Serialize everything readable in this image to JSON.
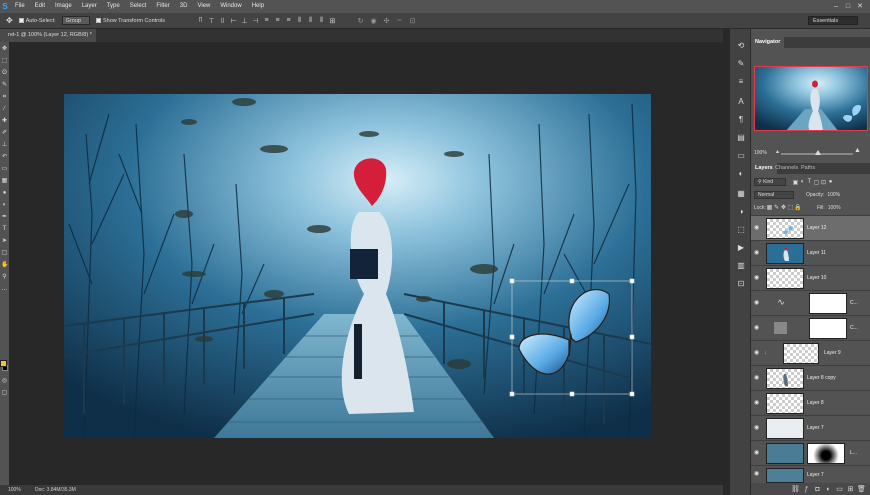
{
  "app": {
    "logo": "S"
  },
  "menu": [
    "File",
    "Edit",
    "Image",
    "Layer",
    "Type",
    "Select",
    "Filter",
    "3D",
    "View",
    "Window",
    "Help"
  ],
  "window_controls": [
    "–",
    "□",
    "✕"
  ],
  "options": {
    "auto_select_label": "Auto-Select:",
    "auto_select_value": "Group",
    "show_transform_label": "Show Transform Controls",
    "workspace": "Essentials"
  },
  "document": {
    "tab_title": "ret-1 @ 100% (Layer 12, RGB/8) *",
    "zoom": "100%",
    "doc_info": "Doc: 3.84M/35.3M"
  },
  "navigator": {
    "tab": "Navigator",
    "zoom": "100%"
  },
  "layers_panel": {
    "tabs": [
      "Layers",
      "Channels",
      "Paths"
    ],
    "kind_label": "Kind",
    "blend_mode": "Normal",
    "opacity_label": "Opacity:",
    "opacity_value": "100%",
    "lock_label": "Lock:",
    "fill_label": "Fill:",
    "fill_value": "100%",
    "layers": [
      {
        "name": "Layer 12",
        "selected": true
      },
      {
        "name": "Layer 11",
        "selected": false
      },
      {
        "name": "Layer 10",
        "selected": false
      },
      {
        "name": "C...",
        "selected": false
      },
      {
        "name": "C...",
        "selected": false
      },
      {
        "name": "Layer 9",
        "selected": false
      },
      {
        "name": "Layer 8 copy",
        "selected": false
      },
      {
        "name": "Layer 8",
        "selected": false
      },
      {
        "name": "Layer 7",
        "selected": false
      },
      {
        "name": "L...",
        "selected": false
      },
      {
        "name": "Layer 7",
        "selected": false
      }
    ]
  },
  "colors": {
    "foreground": "#f1c232",
    "background": "#000000",
    "accent": "#31a8ff",
    "selected_layer": "#6d6d6d"
  }
}
